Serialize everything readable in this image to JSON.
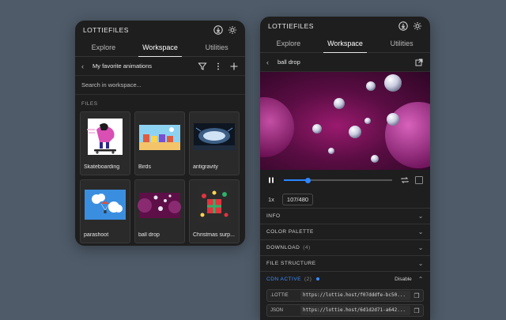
{
  "colors": {
    "background": "#4f5b69",
    "panel": "#1e1e1e",
    "accent": "#2d86ff"
  },
  "left_panel": {
    "brand": "LOTTIEFILES",
    "header_icons": [
      "download-icon",
      "gear-icon"
    ],
    "tabs": [
      {
        "label": "Explore",
        "active": false
      },
      {
        "label": "Workspace",
        "active": true
      },
      {
        "label": "Utilities",
        "active": false
      }
    ],
    "folder": {
      "back_icon": "chevron-left-icon",
      "title": "My favorite animations",
      "tool_icons": [
        "filter-icon",
        "more-icon",
        "plus-icon"
      ]
    },
    "search": {
      "placeholder": "Search in workspace..."
    },
    "section_label": "FILES",
    "files": [
      {
        "label": "Skateboarding"
      },
      {
        "label": "Birds"
      },
      {
        "label": "antigravity"
      },
      {
        "label": "parashoot"
      },
      {
        "label": "ball drop"
      },
      {
        "label": "Christmas surp..."
      }
    ]
  },
  "right_panel": {
    "brand": "LOTTIEFILES",
    "header_icons": [
      "download-icon",
      "gear-icon"
    ],
    "tabs": [
      {
        "label": "Explore",
        "active": false
      },
      {
        "label": "Workspace",
        "active": true
      },
      {
        "label": "Utilities",
        "active": false
      }
    ],
    "file": {
      "back_icon": "chevron-left-icon",
      "title": "ball drop",
      "open_icon": "external-link-icon"
    },
    "player": {
      "progress_fraction": 0.22,
      "speed": "1x",
      "frame": "107/480"
    },
    "sections": [
      {
        "name": "INFO",
        "count": ""
      },
      {
        "name": "COLOR PALETTE",
        "count": ""
      },
      {
        "name": "DOWNLOAD",
        "count": "(4)"
      },
      {
        "name": "FILE STRUCTURE",
        "count": ""
      }
    ],
    "cdn": {
      "name": "CDN ACTIVE",
      "count": "(2)",
      "action": "Disable",
      "rows": [
        {
          "type": ".LOTTIE",
          "url": "https://lottie.host/f07dddfe-bc50..."
        },
        {
          "type": "JSON",
          "url": "https://lottie.host/6d1d2d71-a642..."
        }
      ]
    }
  }
}
